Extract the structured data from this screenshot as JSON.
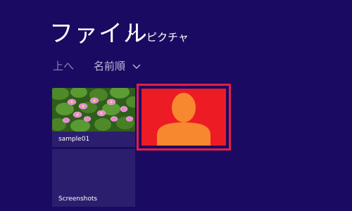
{
  "header": {
    "title": "ファイル",
    "location": "ピクチャ"
  },
  "toolbar": {
    "up_label": "上へ",
    "sort_label": "名前順"
  },
  "tiles": [
    {
      "label": "sample01",
      "icon": "water-lily-photo"
    },
    {
      "label": "",
      "icon": "person-icon",
      "selected": true,
      "background": "#ed1c24",
      "icon_color": "#f7882f"
    },
    {
      "label": "Screenshots",
      "icon": "folder"
    }
  ],
  "colors": {
    "background": "#1b0a62",
    "tile_background": "#2c1e6e",
    "selection_border": "#e51d44"
  }
}
